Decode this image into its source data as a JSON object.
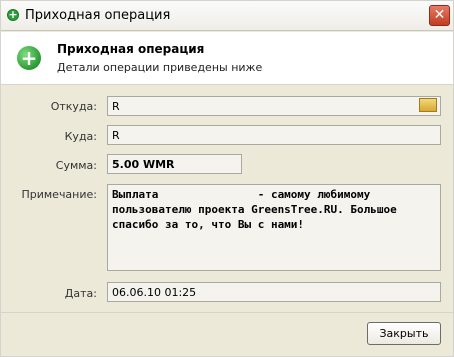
{
  "window": {
    "title": "Приходная операция",
    "close_symbol": "✕"
  },
  "header": {
    "title": "Приходная операция",
    "subtitle": "Детали операции приведены ниже"
  },
  "form": {
    "from_label": "Откуда:",
    "from_value": "R",
    "to_label": "Куда:",
    "to_value": "R",
    "sum_label": "Сумма:",
    "sum_value": "5.00 WMR",
    "note_label": "Примечание:",
    "note_value": "Выплата               - самому любимому\nпользователю проекта GreensTree.RU. Большое\nспасибо за то, что Вы с нами!",
    "date_label": "Дата:",
    "date_value": "06.06.10 01:25"
  },
  "buttons": {
    "close": "Закрыть"
  },
  "icons": {
    "title": "plus-circle-icon",
    "header": "plus-circle-icon",
    "picker": "folder-icon"
  }
}
